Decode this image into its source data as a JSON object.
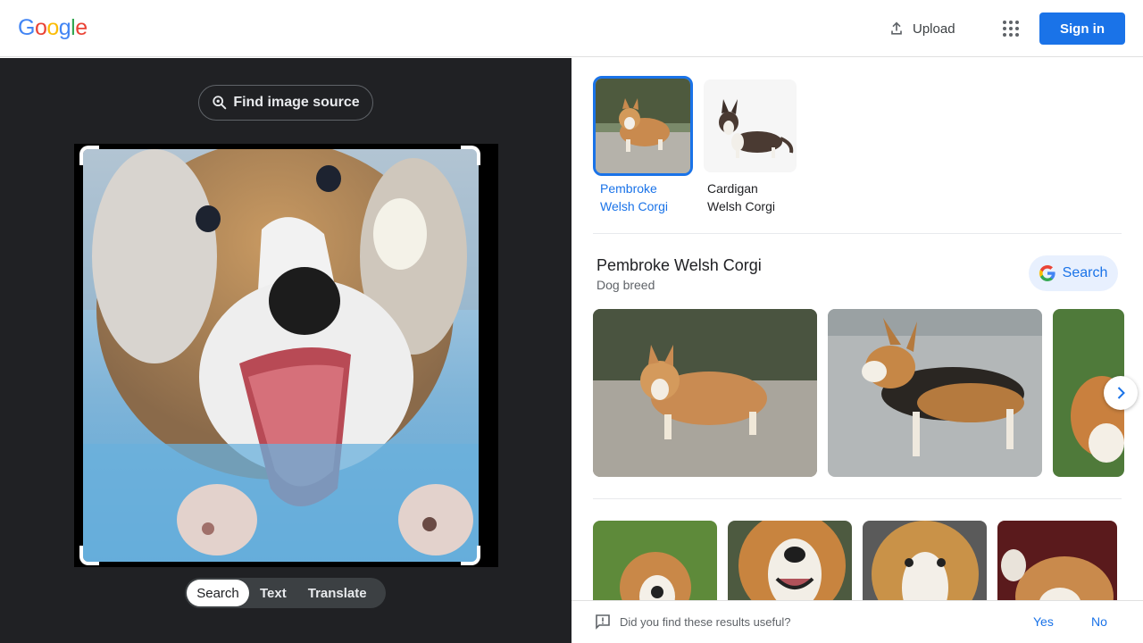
{
  "header": {
    "logo_letters": [
      {
        "ch": "G",
        "color": "#4285F4"
      },
      {
        "ch": "o",
        "color": "#EA4335"
      },
      {
        "ch": "o",
        "color": "#FBBC05"
      },
      {
        "ch": "g",
        "color": "#4285F4"
      },
      {
        "ch": "l",
        "color": "#34A853"
      },
      {
        "ch": "e",
        "color": "#EA4335"
      }
    ],
    "upload_label": "Upload",
    "upload_icon": "upload-icon",
    "apps_icon": "apps-grid-icon",
    "signin_label": "Sign in"
  },
  "left_panel": {
    "find_source_label": "Find image source",
    "find_source_icon": "lens-search-icon",
    "modes": [
      "Search",
      "Text",
      "Translate"
    ],
    "active_mode": "Search"
  },
  "results": {
    "breeds": [
      {
        "label": "Pembroke\nWelsh Corgi",
        "selected": true
      },
      {
        "label": "Cardigan\nWelsh Corgi",
        "selected": false
      }
    ],
    "entity": {
      "title": "Pembroke Welsh Corgi",
      "subtitle": "Dog breed",
      "search_label": "Search"
    }
  },
  "feedback": {
    "question": "Did you find these results useful?",
    "yes": "Yes",
    "no": "No"
  },
  "colors": {
    "accent": "#1a73e8",
    "dark_panel": "#202124"
  }
}
